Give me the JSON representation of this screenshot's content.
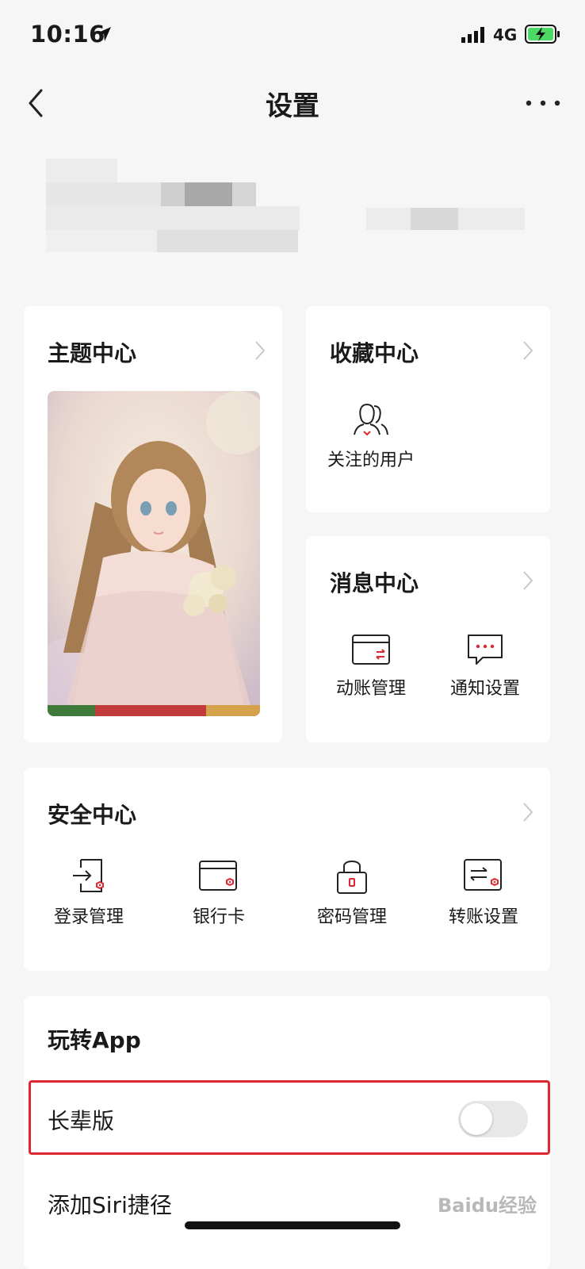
{
  "status_bar": {
    "time": "10:16",
    "network": "4G"
  },
  "nav": {
    "title": "设置"
  },
  "theme_card": {
    "title": "主题中心"
  },
  "favorites_card": {
    "title": "收藏中心",
    "items": [
      {
        "label": "关注的用户",
        "icon": "followed-users-icon"
      }
    ]
  },
  "message_card": {
    "title": "消息中心",
    "items": [
      {
        "label": "动账管理",
        "icon": "account-transaction-icon"
      },
      {
        "label": "通知设置",
        "icon": "notification-icon"
      }
    ]
  },
  "security_card": {
    "title": "安全中心",
    "items": [
      {
        "label": "登录管理",
        "icon": "login-icon"
      },
      {
        "label": "银行卡",
        "icon": "bank-card-icon"
      },
      {
        "label": "密码管理",
        "icon": "lock-icon"
      },
      {
        "label": "转账设置",
        "icon": "transfer-icon"
      }
    ]
  },
  "app_card": {
    "title": "玩转App",
    "elder_mode": {
      "label": "长辈版",
      "enabled": false
    },
    "siri_shortcut": {
      "label": "添加Siri捷径"
    }
  },
  "watermark": "Baidu经验",
  "colors": {
    "accent": "#e0262e",
    "background": "#f6f6f6",
    "card": "#ffffff"
  }
}
